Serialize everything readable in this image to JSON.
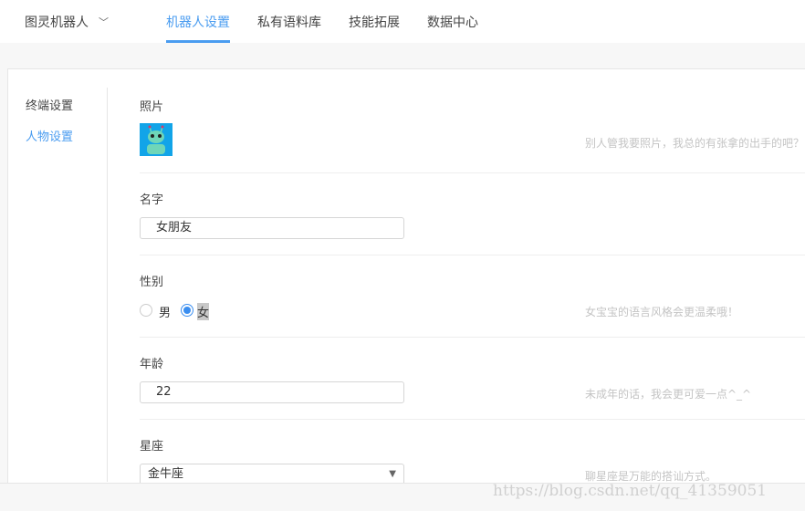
{
  "header": {
    "brand": "图灵机器人",
    "tabs": [
      {
        "label": "机器人设置",
        "active": true
      },
      {
        "label": "私有语料库"
      },
      {
        "label": "技能拓展"
      },
      {
        "label": "数据中心"
      }
    ]
  },
  "sidebar": {
    "items": [
      {
        "label": "终端设置"
      },
      {
        "label": "人物设置",
        "active": true
      }
    ]
  },
  "form": {
    "photo": {
      "label": "照片",
      "hint": "别人管我要照片，我总的有张拿的出手的吧？"
    },
    "name": {
      "label": "名字",
      "value": "女朋友"
    },
    "gender": {
      "label": "性别",
      "options": [
        "男",
        "女"
      ],
      "selected": "女",
      "hint": "女宝宝的语言风格会更温柔哦！"
    },
    "age": {
      "label": "年龄",
      "value": "22",
      "hint": "未成年的话，我会更可爱一点^_^"
    },
    "zodiac": {
      "label": "星座",
      "value": "金牛座",
      "hint": "聊星座是万能的搭讪方式。"
    }
  },
  "watermark": "https://blog.csdn.net/qq_41359051"
}
